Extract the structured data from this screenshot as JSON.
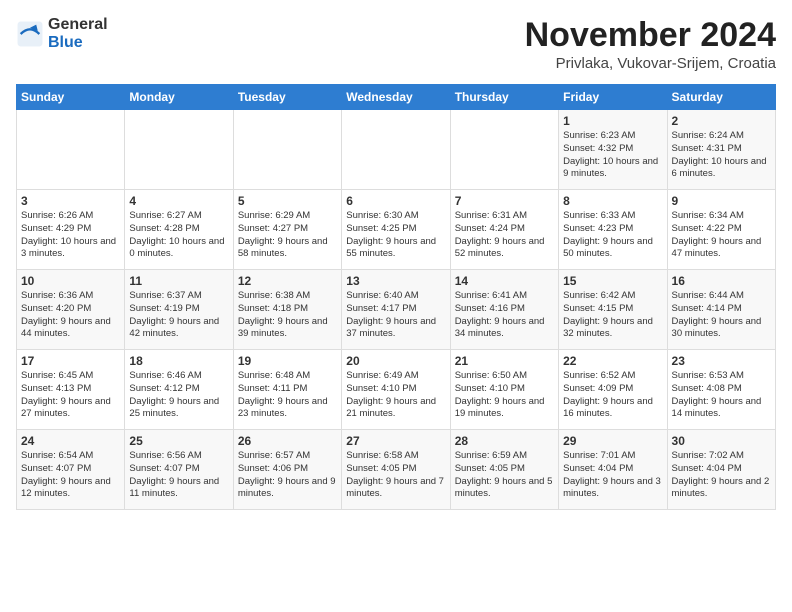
{
  "header": {
    "logo_general": "General",
    "logo_blue": "Blue",
    "month_title": "November 2024",
    "location": "Privlaka, Vukovar-Srijem, Croatia"
  },
  "weekdays": [
    "Sunday",
    "Monday",
    "Tuesday",
    "Wednesday",
    "Thursday",
    "Friday",
    "Saturday"
  ],
  "weeks": [
    [
      {
        "day": "",
        "info": ""
      },
      {
        "day": "",
        "info": ""
      },
      {
        "day": "",
        "info": ""
      },
      {
        "day": "",
        "info": ""
      },
      {
        "day": "",
        "info": ""
      },
      {
        "day": "1",
        "info": "Sunrise: 6:23 AM\nSunset: 4:32 PM\nDaylight: 10 hours and 9 minutes."
      },
      {
        "day": "2",
        "info": "Sunrise: 6:24 AM\nSunset: 4:31 PM\nDaylight: 10 hours and 6 minutes."
      }
    ],
    [
      {
        "day": "3",
        "info": "Sunrise: 6:26 AM\nSunset: 4:29 PM\nDaylight: 10 hours and 3 minutes."
      },
      {
        "day": "4",
        "info": "Sunrise: 6:27 AM\nSunset: 4:28 PM\nDaylight: 10 hours and 0 minutes."
      },
      {
        "day": "5",
        "info": "Sunrise: 6:29 AM\nSunset: 4:27 PM\nDaylight: 9 hours and 58 minutes."
      },
      {
        "day": "6",
        "info": "Sunrise: 6:30 AM\nSunset: 4:25 PM\nDaylight: 9 hours and 55 minutes."
      },
      {
        "day": "7",
        "info": "Sunrise: 6:31 AM\nSunset: 4:24 PM\nDaylight: 9 hours and 52 minutes."
      },
      {
        "day": "8",
        "info": "Sunrise: 6:33 AM\nSunset: 4:23 PM\nDaylight: 9 hours and 50 minutes."
      },
      {
        "day": "9",
        "info": "Sunrise: 6:34 AM\nSunset: 4:22 PM\nDaylight: 9 hours and 47 minutes."
      }
    ],
    [
      {
        "day": "10",
        "info": "Sunrise: 6:36 AM\nSunset: 4:20 PM\nDaylight: 9 hours and 44 minutes."
      },
      {
        "day": "11",
        "info": "Sunrise: 6:37 AM\nSunset: 4:19 PM\nDaylight: 9 hours and 42 minutes."
      },
      {
        "day": "12",
        "info": "Sunrise: 6:38 AM\nSunset: 4:18 PM\nDaylight: 9 hours and 39 minutes."
      },
      {
        "day": "13",
        "info": "Sunrise: 6:40 AM\nSunset: 4:17 PM\nDaylight: 9 hours and 37 minutes."
      },
      {
        "day": "14",
        "info": "Sunrise: 6:41 AM\nSunset: 4:16 PM\nDaylight: 9 hours and 34 minutes."
      },
      {
        "day": "15",
        "info": "Sunrise: 6:42 AM\nSunset: 4:15 PM\nDaylight: 9 hours and 32 minutes."
      },
      {
        "day": "16",
        "info": "Sunrise: 6:44 AM\nSunset: 4:14 PM\nDaylight: 9 hours and 30 minutes."
      }
    ],
    [
      {
        "day": "17",
        "info": "Sunrise: 6:45 AM\nSunset: 4:13 PM\nDaylight: 9 hours and 27 minutes."
      },
      {
        "day": "18",
        "info": "Sunrise: 6:46 AM\nSunset: 4:12 PM\nDaylight: 9 hours and 25 minutes."
      },
      {
        "day": "19",
        "info": "Sunrise: 6:48 AM\nSunset: 4:11 PM\nDaylight: 9 hours and 23 minutes."
      },
      {
        "day": "20",
        "info": "Sunrise: 6:49 AM\nSunset: 4:10 PM\nDaylight: 9 hours and 21 minutes."
      },
      {
        "day": "21",
        "info": "Sunrise: 6:50 AM\nSunset: 4:10 PM\nDaylight: 9 hours and 19 minutes."
      },
      {
        "day": "22",
        "info": "Sunrise: 6:52 AM\nSunset: 4:09 PM\nDaylight: 9 hours and 16 minutes."
      },
      {
        "day": "23",
        "info": "Sunrise: 6:53 AM\nSunset: 4:08 PM\nDaylight: 9 hours and 14 minutes."
      }
    ],
    [
      {
        "day": "24",
        "info": "Sunrise: 6:54 AM\nSunset: 4:07 PM\nDaylight: 9 hours and 12 minutes."
      },
      {
        "day": "25",
        "info": "Sunrise: 6:56 AM\nSunset: 4:07 PM\nDaylight: 9 hours and 11 minutes."
      },
      {
        "day": "26",
        "info": "Sunrise: 6:57 AM\nSunset: 4:06 PM\nDaylight: 9 hours and 9 minutes."
      },
      {
        "day": "27",
        "info": "Sunrise: 6:58 AM\nSunset: 4:05 PM\nDaylight: 9 hours and 7 minutes."
      },
      {
        "day": "28",
        "info": "Sunrise: 6:59 AM\nSunset: 4:05 PM\nDaylight: 9 hours and 5 minutes."
      },
      {
        "day": "29",
        "info": "Sunrise: 7:01 AM\nSunset: 4:04 PM\nDaylight: 9 hours and 3 minutes."
      },
      {
        "day": "30",
        "info": "Sunrise: 7:02 AM\nSunset: 4:04 PM\nDaylight: 9 hours and 2 minutes."
      }
    ]
  ]
}
